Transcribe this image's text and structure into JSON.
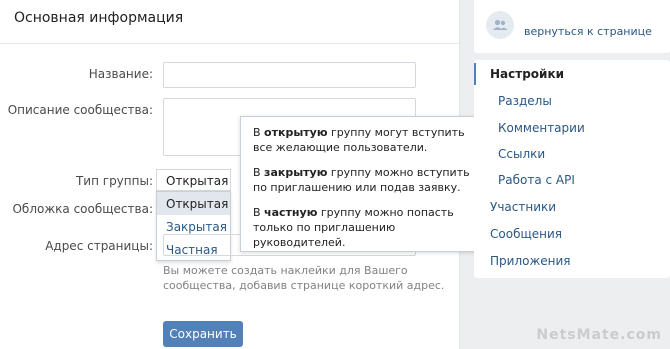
{
  "main": {
    "title": "Основная информация",
    "labels": {
      "name": "Название:",
      "description": "Описание сообщества:",
      "group_type": "Тип группы:",
      "cover": "Обложка сообщества:",
      "address": "Адрес страницы:"
    },
    "group_type_selected": "Открытая",
    "group_type_options": [
      "Открытая",
      "Закрытая",
      "Частная"
    ],
    "hint": "Вы можете создать наклейки для Вашего сообщества, добавив странице короткий адрес.",
    "save_label": "Сохранить"
  },
  "tooltip": {
    "open": {
      "pre": "В ",
      "em": "открытую",
      "post": " группу могут вступить все желающие пользователи."
    },
    "closed": {
      "pre": "В ",
      "em": "закрытую",
      "post": " группу можно вступить по приглашению или подав заявку."
    },
    "private": {
      "pre": "В ",
      "em": "частную",
      "post": " группу можно попасть только по приглашению руководителей."
    }
  },
  "sidebar": {
    "back_label": "вернуться к странице",
    "avatar_icon": "group-icon",
    "items": [
      "Настройки",
      "Разделы",
      "Комментарии",
      "Ссылки",
      "Работа с API",
      "Участники",
      "Сообщения",
      "Приложения"
    ]
  },
  "watermark": "NetsMate.com",
  "colors": {
    "accent": "#5181b8",
    "link": "#2a5885"
  }
}
